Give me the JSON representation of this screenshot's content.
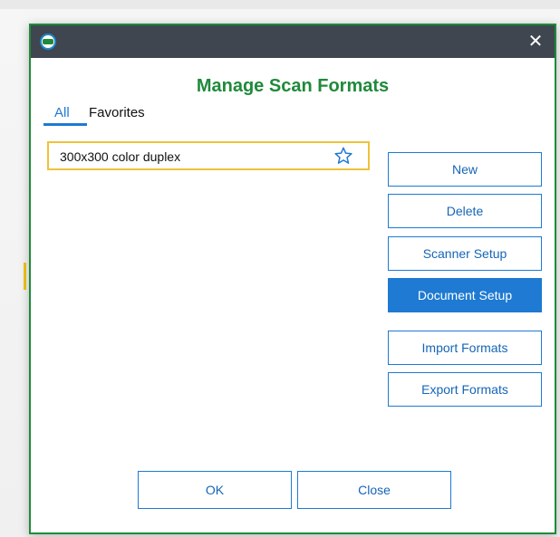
{
  "dialog": {
    "title": "Manage Scan Formats",
    "close_glyph": "✕",
    "app_icon": "app-logo-icon",
    "accent_color": "#1f8a3a",
    "titlebar_color": "#3f4650"
  },
  "tabs": [
    {
      "label": "All",
      "selected": true
    },
    {
      "label": "Favorites",
      "selected": false
    }
  ],
  "formats": [
    {
      "label": "300x300 color duplex",
      "favorite": false,
      "icon": "star-outline-icon"
    }
  ],
  "actions": {
    "new_label": "New",
    "delete_label": "Delete",
    "scanner_setup_label": "Scanner Setup",
    "document_setup_label": "Document Setup",
    "import_label": "Import Formats",
    "export_label": "Export Formats"
  },
  "footer": {
    "ok_label": "OK",
    "close_label": "Close"
  },
  "colors": {
    "primary_blue": "#1e7ad2",
    "selection_border": "#f0c23a"
  }
}
